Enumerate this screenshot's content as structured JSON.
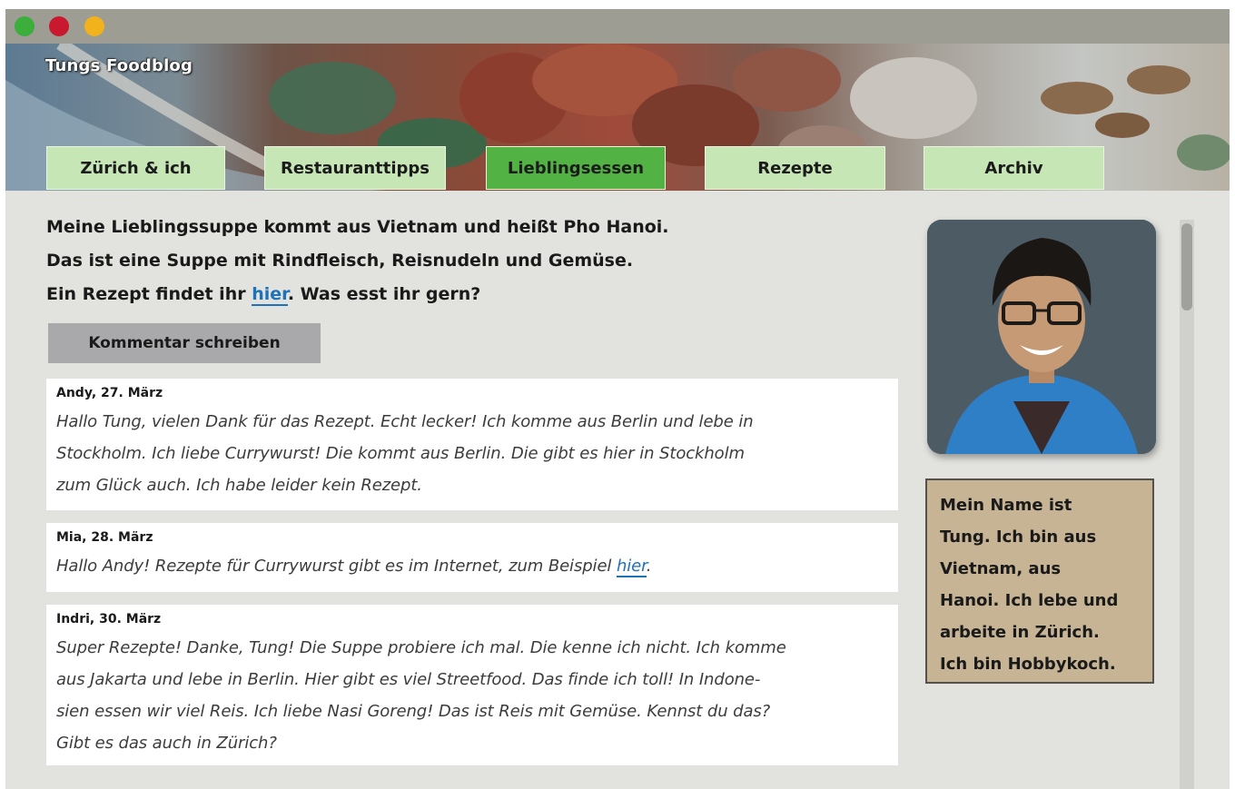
{
  "window": {
    "controls": [
      "green-dot",
      "red-dot",
      "yellow-dot"
    ]
  },
  "header": {
    "blog_title": "Tungs Foodblog"
  },
  "nav": {
    "tabs": [
      {
        "label": "Zürich & ich",
        "active": false
      },
      {
        "label": "Restauranttipps",
        "active": false
      },
      {
        "label": "Lieblingsessen",
        "active": true
      },
      {
        "label": "Rezepte",
        "active": false
      },
      {
        "label": "Archiv",
        "active": false
      }
    ]
  },
  "post": {
    "line1": "Meine Lieblingssuppe kommt aus Vietnam und heißt Pho Hanoi.",
    "line2": "Das ist eine Suppe mit Rindfleisch, Reisnudeln und Gemüse.",
    "line3_before": "Ein Rezept findet ihr ",
    "line3_link": "hier",
    "line3_after": ". Was esst ihr gern?"
  },
  "comment_button": "Kommentar schreiben",
  "comments": [
    {
      "author": "Andy, 27. März",
      "lines": [
        "Hallo Tung, vielen Dank für das Rezept. Echt lecker! Ich komme aus Berlin und lebe in",
        "Stockholm. Ich liebe Currywurst! Die kommt aus Berlin. Die gibt es hier in Stockholm",
        "zum Glück auch. Ich habe leider kein Rezept."
      ]
    },
    {
      "author": "Mia, 28. März",
      "text_before": "Hallo Andy! Rezepte für Currywurst gibt es im Internet, zum Beispiel ",
      "link": "hier",
      "text_after": "."
    },
    {
      "author": "Indri, 30. März",
      "lines": [
        "Super Rezepte! Danke, Tung! Die Suppe probiere ich mal. Die kenne ich nicht. Ich komme",
        "aus Jakarta und lebe in Berlin. Hier gibt es viel Streetfood. Das finde ich toll! In Indone-",
        "sien essen wir viel Reis. Ich liebe Nasi Goreng! Das ist Reis mit Gemüse. Kennst du das?",
        "Gibt es das auch in Zürich?"
      ]
    }
  ],
  "sidebar": {
    "bio_lines": [
      "Mein Name ist",
      "Tung. Ich bin aus",
      "Vietnam, aus",
      "Hanoi. Ich lebe und",
      "arbeite in Zürich.",
      "Ich bin Hobbykoch."
    ]
  },
  "colors": {
    "tab": "#c7e6b5",
    "tab_active": "#52b244",
    "link": "#1d72b8",
    "bio_bg": "#c7b494",
    "page_bg": "#e2e2de"
  }
}
